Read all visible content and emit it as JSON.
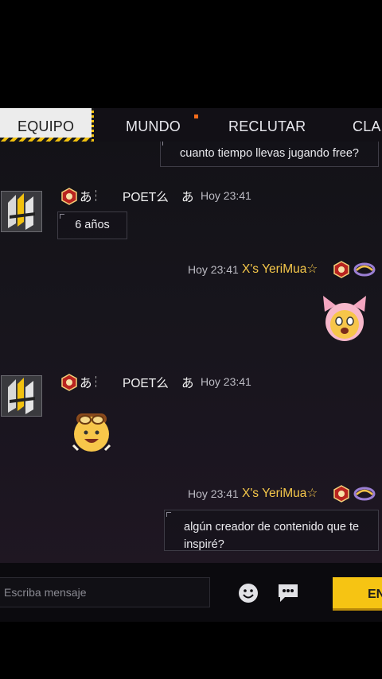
{
  "tabs": [
    {
      "label": "EQUIPO",
      "active": true
    },
    {
      "label": "MUNDO"
    },
    {
      "label": "RECLUTAR"
    },
    {
      "label": "CLAN"
    }
  ],
  "messages": {
    "top_bubble": "cuanto tiempo llevas jugando free?",
    "reply_1": {
      "jp1": "あ",
      "name": "POET么",
      "jp2": "あ",
      "time": "Hoy 23:41",
      "text": "6 años"
    },
    "mine_1": {
      "time": "Hoy 23:41",
      "user": "X's YeriMua☆"
    },
    "reply_2": {
      "jp1": "あ",
      "name": "POET么",
      "jp2": "あ",
      "time": "Hoy 23:41"
    },
    "mine_2": {
      "time": "Hoy 23:41",
      "user": "X's YeriMua☆",
      "text": "algún creador de contenido que te inspiré?"
    }
  },
  "input": {
    "placeholder": "Escriba mensaje",
    "value": ""
  },
  "send_label": "ENVIAR",
  "icons": {
    "emoji": "smiley-icon",
    "chat": "chat-bubble-icon",
    "badge": "rank-badge-icon"
  },
  "colors": {
    "accent": "#f6c413",
    "username": "#f6c84a",
    "notification": "#f36b1b"
  }
}
